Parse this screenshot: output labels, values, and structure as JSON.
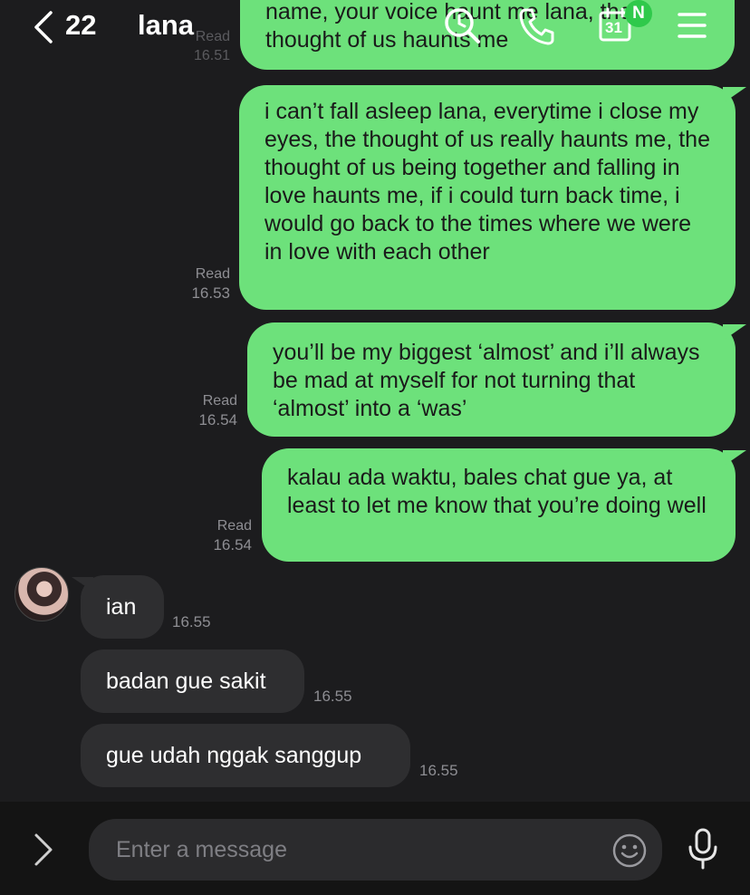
{
  "header": {
    "unread_count": "22",
    "chat_name": "lana",
    "badge_label": "N",
    "calendar_day": "31",
    "colors": {
      "badge": "#2fc94b"
    }
  },
  "messages": {
    "partial_top": {
      "line1": "name, your voice haunt me lana, the",
      "line2": "thought of us haunts me",
      "read": "Read",
      "time": "16.51"
    },
    "out": [
      {
        "text": "i can’t fall asleep lana, everytime i close my eyes, the thought of us really haunts me, the thought of us being together and falling in love haunts me, if i could turn back time, i would go back to the times where we were in love with each other",
        "read": "Read",
        "time": "16.53"
      },
      {
        "text": "you’ll be my biggest ‘almost’ and i’ll always be mad at myself for not turning that ‘almost’ into a ‘was’",
        "read": "Read",
        "time": "16.54"
      },
      {
        "text": "kalau ada waktu, bales chat gue ya, at least to let me know that you’re doing well",
        "read": "Read",
        "time": "16.54"
      }
    ],
    "in": [
      {
        "text": "ian",
        "time": "16.55"
      },
      {
        "text": "badan gue sakit",
        "time": "16.55"
      },
      {
        "text": "gue udah nggak sanggup",
        "time": "16.55"
      }
    ],
    "colors": {
      "outgoing": "#6de17b",
      "incoming": "#2e2e30"
    }
  },
  "composer": {
    "placeholder": "Enter a message"
  },
  "icons": {
    "back": "chevron-left-icon",
    "search": "search-icon",
    "call": "phone-icon",
    "calendar": "calendar-icon",
    "menu": "menu-icon",
    "expand": "chevron-right-icon",
    "emoji": "emoji-icon",
    "mic": "microphone-icon"
  }
}
